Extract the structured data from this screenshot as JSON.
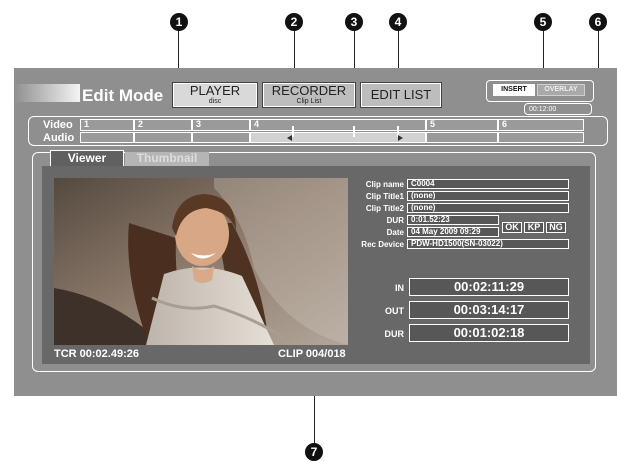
{
  "callouts": [
    "1",
    "2",
    "3",
    "4",
    "5",
    "6",
    "7"
  ],
  "header": {
    "title": "Edit Mode",
    "player": {
      "label": "PLAYER",
      "sub": "disc"
    },
    "recorder": {
      "label": "RECORDER",
      "sub": "Clip List"
    },
    "edit_list": {
      "label": "EDIT LIST"
    },
    "insert_label": "INSERT",
    "overlay_label": "OVERLAY",
    "duration": "00:12:00"
  },
  "timeline": {
    "video_label": "Video",
    "audio_label": "Audio",
    "segments": [
      "1",
      "2",
      "3",
      "4",
      "5",
      "6"
    ]
  },
  "tabs": {
    "viewer": "Viewer",
    "thumbnail": "Thumbnail"
  },
  "viewer": {
    "tcr": "TCR 00:02.49:26",
    "clip": "CLIP 004/018"
  },
  "clip_info": {
    "clip_name_label": "Clip name",
    "clip_name": "C0004",
    "title1_label": "Clip Title1",
    "title1": "(none)",
    "title2_label": "Clip Title2",
    "title2": "(none)",
    "dur_label": "DUR",
    "dur": "0:01.52:23",
    "date_label": "Date",
    "date": "04 May 2009 09:29",
    "device_label": "Rec Device",
    "device": "PDW-HD1500(SN-03022)",
    "flag_ok": "OK",
    "flag_kp": "KP",
    "flag_ng": "NG"
  },
  "timecodes": {
    "in_label": "IN",
    "in": "00:02:11:29",
    "out_label": "OUT",
    "out": "00:03:14:17",
    "dur_label": "DUR",
    "dur": "00:01:02:18"
  },
  "colors": {
    "screen": "#8f8f8f",
    "panel": "#686868",
    "callout": "#111111"
  }
}
